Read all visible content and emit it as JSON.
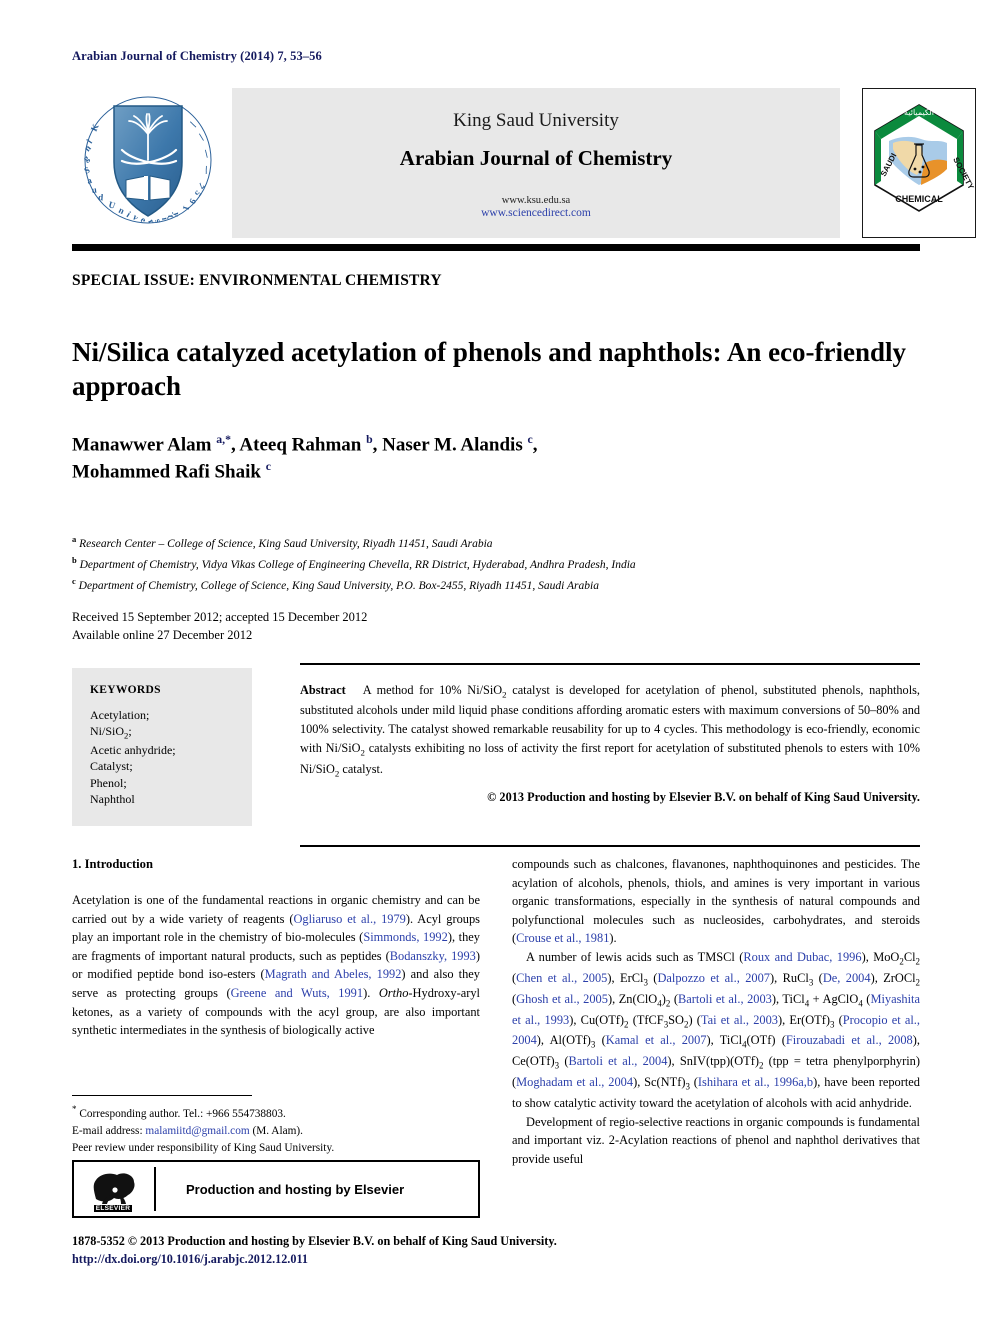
{
  "running_head": "Arabian Journal of Chemistry (2014) 7, 53–56",
  "masthead": {
    "university": "King Saud University",
    "journal_title": "Arabian Journal of Chemistry",
    "url_ksu": "www.ksu.edu.sa",
    "url_sciencedirect": "www.sciencedirect.com",
    "ksu_logo_alt": "King Saud University 1957",
    "scs_logo_alt": "Saudi Chemical Society"
  },
  "special_issue": "SPECIAL ISSUE: ENVIRONMENTAL CHEMISTRY",
  "article": {
    "title": "Ni/Silica catalyzed acetylation of phenols and naphthols: An eco-friendly approach",
    "authors_html": "Manawwer Alam <sup>a,*</sup>, Ateeq Rahman <sup>b</sup>, Naser M. Alandis <sup>c</sup>,<br>Mohammed Rafi Shaik <sup>c</sup>",
    "affiliations": [
      {
        "marker": "a",
        "text": "Research Center – College of Science, King Saud University, Riyadh 11451, Saudi Arabia"
      },
      {
        "marker": "b",
        "text": "Department of Chemistry, Vidya Vikas College of Engineering Chevella, RR District, Hyderabad, Andhra Pradesh, India"
      },
      {
        "marker": "c",
        "text": "Department of Chemistry, College of Science, King Saud University, P.O. Box-2455, Riyadh 11451, Saudi Arabia"
      }
    ],
    "history_line1": "Received 15 September 2012; accepted 15 December 2012",
    "history_line2": "Available online 27 December 2012"
  },
  "keywords": {
    "heading": "KEYWORDS",
    "items": [
      "Acetylation;",
      "Ni/SiO<sub>2</sub>;",
      "Acetic anhydride;",
      "Catalyst;",
      "Phenol;",
      "Naphthol"
    ]
  },
  "abstract": {
    "label": "Abstract",
    "text_html": "A method for 10% Ni/SiO<sub>2</sub> catalyst is developed for acetylation of phenol, substituted phenols, naphthols, substituted alcohols under mild liquid phase conditions affording aromatic esters with maximum conversions of 50–80% and 100% selectivity. The catalyst showed remarkable reusability for up to 4 cycles. This methodology is eco-friendly, economic with Ni/SiO<sub>2</sub> catalysts exhibiting no loss of activity the first report for acetylation of substituted phenols to esters with 10% Ni/SiO<sub>2</sub> catalyst.",
    "copyright": "© 2013 Production and hosting by Elsevier B.V. on behalf of King Saud University."
  },
  "body": {
    "section_heading": "1. Introduction",
    "left_paragraphs_html": [
      "Acetylation is one of the fundamental reactions in organic chemistry and can be carried out by a wide variety of reagents (<span class=\"cite\">Ogliaruso et al., 1979</span>). Acyl groups play an important role in the chemistry of bio-molecules (<span class=\"cite\">Simmonds, 1992</span>), they are fragments of important natural products, such as peptides (<span class=\"cite\">Bodanszky, 1993</span>) or modified peptide bond iso-esters (<span class=\"cite\">Magrath and Abeles, 1992</span>) and also they serve as protecting groups (<span class=\"cite\">Greene and Wuts, 1991</span>). <span class=\"ital\">Ortho</span>-Hydroxy-aryl ketones, as a variety of compounds with the acyl group, are also important synthetic intermediates in the synthesis of biologically active"
    ],
    "right_paragraphs_html": [
      "compounds such as chalcones, flavanones, naphthoquinones and pesticides. The acylation of alcohols, phenols, thiols, and amines is very important in various organic transformations, especially in the synthesis of natural compounds and polyfunctional molecules such as nucleosides, carbohydrates, and steroids (<span class=\"cite\">Crouse et al., 1981</span>).",
      "A number of lewis acids such as TMSCl (<span class=\"cite\">Roux and Dubac, 1996</span>), MoO<sub>2</sub>Cl<sub>2</sub> (<span class=\"cite\">Chen et al., 2005</span>), ErCl<sub>3</sub> (<span class=\"cite\">Dalpozzo et al., 2007</span>), RuCl<sub>3</sub> (<span class=\"cite\">De, 2004</span>), ZrOCl<sub>2</sub> (<span class=\"cite\">Ghosh et al., 2005</span>), Zn(ClO<sub>4</sub>)<sub>2</sub> (<span class=\"cite\">Bartoli et al., 2003</span>), TiCl<sub>4</sub> + AgClO<sub>4</sub> (<span class=\"cite\">Miyashita et al., 1993</span>), Cu(OTf)<sub>2</sub> (TfCF<sub>3</sub>SO<sub>2</sub>) (<span class=\"cite\">Tai et al., 2003</span>), Er(OTf)<sub>3</sub> (<span class=\"cite\">Procopio et al., 2004</span>), Al(OTf)<sub>3</sub> (<span class=\"cite\">Kamal et al., 2007</span>), TiCl<sub>4</sub>(OTf) (<span class=\"cite\">Firouzabadi et al., 2008</span>), Ce(OTf)<sub>3</sub> (<span class=\"cite\">Bartoli et al., 2004</span>), SnIV(tpp)(OTf)<sub>2</sub> (tpp = tetra phenylporphyrin) (<span class=\"cite\">Moghadam et al., 2004</span>), Sc(NTf)<sub>3</sub> (<span class=\"cite\">Ishihara et al., 1996a,b</span>), have been reported to show catalytic activity toward the acetylation of alcohols with acid anhydride.",
      "Development of regio-selective reactions in organic compounds is fundamental and important viz. 2-Acylation reactions of phenol and naphthol derivatives that provide useful"
    ]
  },
  "footnotes": {
    "corresponding_html": "<span class=\"star\">*</span> Corresponding author. Tel.: +966 554738803.",
    "email_html": "E-mail address: <span class=\"mail\">malamiitd@gmail.com</span> (M. Alam).",
    "peer_review": "Peer review under responsibility of King Saud University.",
    "elsevier_banner": "Production and hosting by Elsevier",
    "elsevier_wordmark": "ELSEVIER"
  },
  "colophon": {
    "issn_line": "1878-5352 © 2013 Production and hosting by Elsevier B.V. on behalf of King Saud University.",
    "doi": "http://dx.doi.org/10.1016/j.arabjc.2012.12.011"
  },
  "colors": {
    "navy": "#14195e",
    "link_blue": "#2b3faa",
    "band_gray": "#e8e8e8",
    "logo_blue": "#2a6099",
    "scs_green": "#0b8a3d",
    "scs_orange": "#e8922a"
  }
}
